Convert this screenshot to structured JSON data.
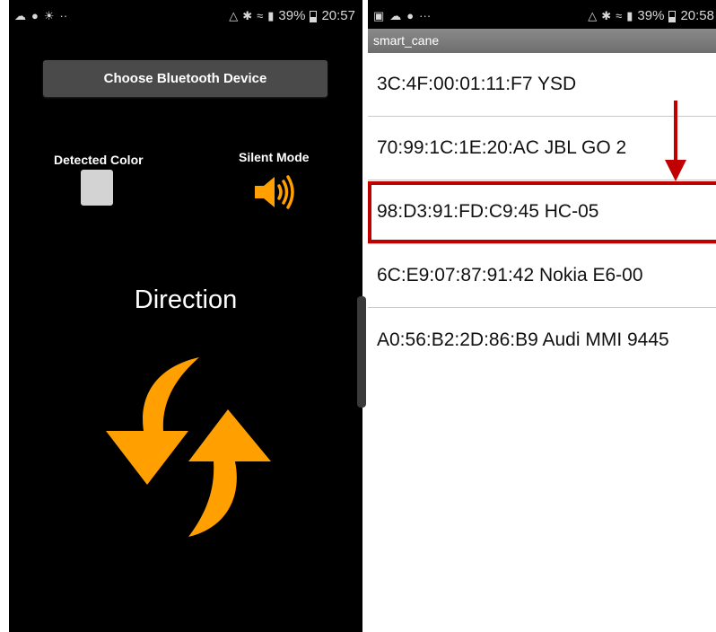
{
  "left_screen": {
    "status_bar": {
      "icons_left": [
        "cloud-icon",
        "messenger-icon",
        "weather-icon",
        "dots-icon"
      ],
      "icons_right": [
        "warning-icon",
        "bluetooth-icon",
        "wifi-icon",
        "signal-icon"
      ],
      "battery": "39%",
      "time": "20:57"
    },
    "bt_button_label": "Choose Bluetooth Device",
    "detected_color_label": "Detected Color",
    "detected_color_value": "#d3d3d3",
    "silent_mode_label": "Silent Mode",
    "direction_label": "Direction",
    "accent_color": "#ffa000"
  },
  "right_screen": {
    "status_bar": {
      "icons_left": [
        "image-icon",
        "cloud-icon",
        "messenger-icon",
        "dots-icon"
      ],
      "icons_right": [
        "warning-icon",
        "bluetooth-icon",
        "wifi-icon",
        "signal-icon"
      ],
      "battery": "39%",
      "time": "20:58"
    },
    "title": "smart_cane",
    "devices": [
      "3C:4F:00:01:11:F7 YSD",
      "70:99:1C:1E:20:AC JBL GO 2",
      "98:D3:91:FD:C9:45 HC-05",
      "6C:E9:07:87:91:42 Nokia E6-00",
      "A0:56:B2:2D:86:B9 Audi MMI 9445"
    ],
    "highlight_color": "#c00000"
  }
}
